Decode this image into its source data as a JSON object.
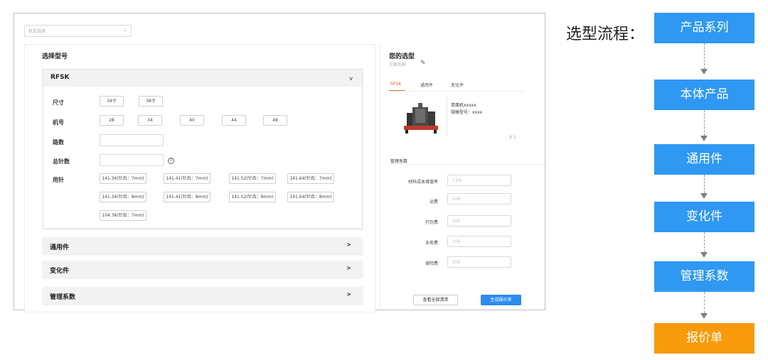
{
  "screenshot": {
    "model_select": {
      "placeholder": "机型选择",
      "chevron": "chevron-down-icon"
    },
    "left": {
      "title": "选择型号",
      "open_section": {
        "title": "RFSK",
        "toggle": "v",
        "rows": {
          "size": {
            "label": "尺寸",
            "options": [
              "34寸",
              "38寸"
            ]
          },
          "model": {
            "label": "机号",
            "options": [
              "28",
              "34",
              "40",
              "44",
              "48"
            ]
          },
          "paths": {
            "label": "路数",
            "value": ""
          },
          "total_needles": {
            "label": "总针数",
            "value": "",
            "help": "?"
          },
          "needles": {
            "label": "用针",
            "options": [
              "141.36(针齿：7mm)",
              "141.41(针齿：7mm)",
              "141.52(针齿：7mm)",
              "141.64(针齿：7mm)",
              "141.36(针齿：8mm)",
              "141.41(针齿：8mm)",
              "141.52(针齿：8mm)",
              "141.64(针齿：8mm)",
              "104.36(针齿：7mm)"
            ]
          }
        }
      },
      "collapsed_sections": [
        {
          "title": "通用件",
          "arrow": ">"
        },
        {
          "title": "变化件",
          "arrow": ">"
        },
        {
          "title": "管理系数",
          "arrow": ">"
        }
      ]
    },
    "right": {
      "title": "您的选型",
      "subtitle": "方案名称",
      "edit_icon": "pencil-icon",
      "tabs": [
        "RFSK",
        "通用件",
        "变化件"
      ],
      "active_tab": 0,
      "product": {
        "name": "单面机xxxxx",
        "spec": "规格型号：xxxx",
        "qty": "X 1"
      },
      "mgmt_label": "管理系数",
      "fields": [
        {
          "label": "材料成本增值率",
          "value": "13%"
        },
        {
          "label": "运费",
          "value": "100"
        },
        {
          "label": "打包费",
          "value": "100"
        },
        {
          "label": "业务费",
          "value": "100"
        },
        {
          "label": "保险费",
          "value": "100"
        }
      ],
      "buttons": {
        "view_all": "查看全部清单",
        "generate": "生成报价单"
      }
    }
  },
  "flow": {
    "heading": "选型流程：",
    "steps": [
      "产品系列",
      "本体产品",
      "通用件",
      "变化件",
      "管理系数",
      "报价单"
    ],
    "colors": {
      "step": "#2f98f2",
      "final": "#f99a0b",
      "accent": "#e8682b",
      "primary_button": "#2d8cf0"
    }
  }
}
